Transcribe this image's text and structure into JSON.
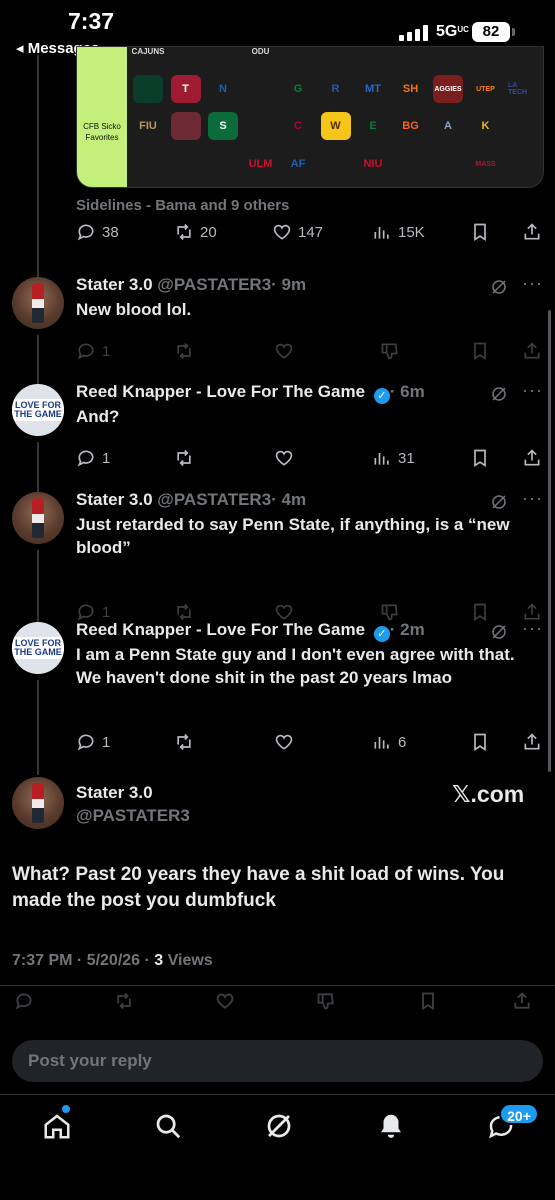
{
  "status_bar": {
    "time": "7:37",
    "back_label": "◂ Messages",
    "network": "5G",
    "network_sup": "UC",
    "battery": "82"
  },
  "quoted_image": {
    "tier_label": "CFB Sicko Favorites",
    "top_logos": [
      "CAJUNS",
      "",
      "",
      "ODU",
      "",
      "",
      "",
      "",
      "",
      "",
      "",
      ""
    ],
    "logos": [
      {
        "text": "",
        "bg": "#0a3d2a",
        "fg": "#f47321"
      },
      {
        "text": "T",
        "bg": "#9e1b32",
        "fg": "#fff"
      },
      {
        "text": "N",
        "bg": "#1c1c1c",
        "fg": "#1a5fb4"
      },
      {
        "text": "",
        "bg": "#1c1c1c",
        "fg": "#cfb53b"
      },
      {
        "text": "G",
        "bg": "#1c1c1c",
        "fg": "#0f7a3a"
      },
      {
        "text": "R",
        "bg": "#1c1c1c",
        "fg": "#2a59a8"
      },
      {
        "text": "MT",
        "bg": "#1c1c1c",
        "fg": "#2b66c2"
      },
      {
        "text": "SH",
        "bg": "#1c1c1c",
        "fg": "#f47321"
      },
      {
        "text": "AGGIES",
        "bg": "#7b1e1e",
        "fg": "#fff"
      },
      {
        "text": "UTEP",
        "bg": "#1c1c1c",
        "fg": "#ff8200"
      },
      {
        "text": "LA TECH",
        "bg": "#1c1c1c",
        "fg": "#2c4aa8"
      },
      {
        "text": "FIU",
        "bg": "#1c1c1c",
        "fg": "#b8975a"
      },
      {
        "text": "",
        "bg": "#6d2a33",
        "fg": "#fff"
      },
      {
        "text": "S",
        "bg": "#0b6b3a",
        "fg": "#fff"
      },
      {
        "text": "",
        "bg": "#1c1c1c",
        "fg": "#c41230"
      },
      {
        "text": "C",
        "bg": "#1c1c1c",
        "fg": "#b5002f"
      },
      {
        "text": "W",
        "bg": "#f5c518",
        "fg": "#5a2b00"
      },
      {
        "text": "E",
        "bg": "#1c1c1c",
        "fg": "#0b7a3b"
      },
      {
        "text": "BG",
        "bg": "#1c1c1c",
        "fg": "#f26522"
      },
      {
        "text": "A",
        "bg": "#1c1c1c",
        "fg": "#8aa0c8"
      },
      {
        "text": "K",
        "bg": "#1c1c1c",
        "fg": "#f2b51f"
      },
      {
        "text": "",
        "bg": "#1c1c1c",
        "fg": "#1e5fb4"
      },
      {
        "text": "",
        "bg": "#1c1c1c",
        "fg": "#c9a24b"
      },
      {
        "text": "",
        "bg": "#1c1c1c",
        "fg": "#1a72c4"
      },
      {
        "text": "",
        "bg": "#1c1c1c",
        "fg": "#b22222"
      },
      {
        "text": "ULM",
        "bg": "#1c1c1c",
        "fg": "#c8102e"
      },
      {
        "text": "AF",
        "bg": "#1c1c1c",
        "fg": "#1c5fb4"
      },
      {
        "text": "",
        "bg": "#1c1c1c",
        "fg": "#1e6b3a"
      },
      {
        "text": "NIU",
        "bg": "#1c1c1c",
        "fg": "#c8102e"
      },
      {
        "text": "",
        "bg": "#1c1c1c",
        "fg": "#8b5a2b"
      },
      {
        "text": "",
        "bg": "#1c1c1c",
        "fg": "#1b4f9a"
      },
      {
        "text": "MASS",
        "bg": "#1c1c1c",
        "fg": "#a6192e"
      }
    ]
  },
  "parent_tweet": {
    "social_context": "Sidelines - Bama and 9 others",
    "replies": "38",
    "reposts": "20",
    "likes": "147",
    "views": "15K"
  },
  "replies": [
    {
      "avatar": "stater",
      "name": "Stater 3.0",
      "handle": "@PASTATER3",
      "time": "· 9m",
      "text": "New blood lol.",
      "replies": "1",
      "views": ""
    },
    {
      "avatar": "reed",
      "name": "Reed Knapper - Love For The Game",
      "verified": true,
      "time": "· 6m",
      "text": "And?",
      "replies": "1",
      "views": "31"
    },
    {
      "avatar": "stater",
      "name": "Stater 3.0",
      "handle": "@PASTATER3",
      "time": "· 4m",
      "text": "Just retarded to say Penn State, if anything, is a “new blood”",
      "replies": "1",
      "views": ""
    },
    {
      "avatar": "reed",
      "name": "Reed Knapper - Love For The Game",
      "verified": true,
      "time": "· 2m",
      "text": "I am a Penn State guy and I don't even agree with that. We haven't done shit in the past 20 years lmao",
      "replies": "1",
      "views": "6"
    }
  ],
  "avatar_text": {
    "reed": "LOVE FOR THE GAME"
  },
  "main_post": {
    "name": "Stater 3.0",
    "handle": "@PASTATER3",
    "watermark": "𝕏.com",
    "text": "What? Past 20 years they have a shit load of wins. You made the post you dumbfuck",
    "timestamp": "7:37 PM · 5/20/26 · ",
    "views_count": "3",
    "views_label": " Views"
  },
  "composer": {
    "placeholder": "Post your reply"
  },
  "tabbar": {
    "messages_badge": "20+"
  },
  "colors": {
    "accent": "#1d9bf0",
    "background": "#000000",
    "muted": "#71767b"
  }
}
